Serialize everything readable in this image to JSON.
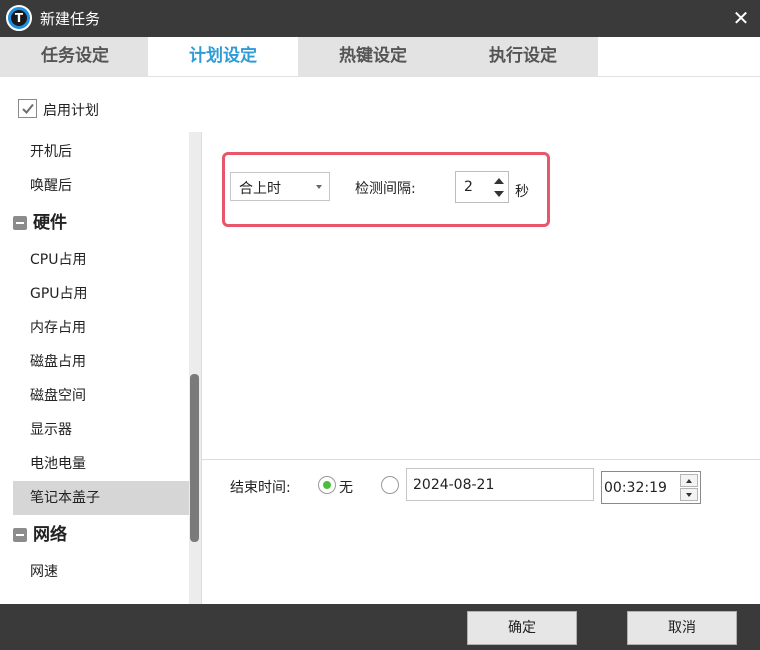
{
  "window": {
    "title": "新建任务",
    "icon_letter": "T"
  },
  "tabs": [
    {
      "label": "任务设定",
      "active": false
    },
    {
      "label": "计划设定",
      "active": true
    },
    {
      "label": "热键设定",
      "active": false
    },
    {
      "label": "执行设定",
      "active": false
    }
  ],
  "enable_plan": {
    "label": "启用计划",
    "checked": true
  },
  "sidebar": {
    "items": [
      {
        "kind": "item",
        "label": "开机后"
      },
      {
        "kind": "item",
        "label": "唤醒后"
      },
      {
        "kind": "group",
        "label": "硬件"
      },
      {
        "kind": "item",
        "label": "CPU占用"
      },
      {
        "kind": "item",
        "label": "GPU占用"
      },
      {
        "kind": "item",
        "label": "内存占用"
      },
      {
        "kind": "item",
        "label": "磁盘占用"
      },
      {
        "kind": "item",
        "label": "磁盘空间"
      },
      {
        "kind": "item",
        "label": "显示器"
      },
      {
        "kind": "item",
        "label": "电池电量"
      },
      {
        "kind": "item",
        "label": "笔记本盖子",
        "selected": true
      },
      {
        "kind": "group",
        "label": "网络"
      },
      {
        "kind": "item",
        "label": "网速"
      }
    ]
  },
  "condition": {
    "select_value": "合上时",
    "interval_label": "检测间隔:",
    "interval_value": "2",
    "interval_unit": "秒"
  },
  "end_time": {
    "label": "结束时间:",
    "none_label": "无",
    "none_checked": true,
    "date_checked": false,
    "date_value": "2024-08-21",
    "time_value": "00:32:19"
  },
  "footer": {
    "ok_label": "确定",
    "cancel_label": "取消"
  },
  "colors": {
    "accent": "#2e9bd6",
    "highlight": "#e8566c",
    "titlebar": "#3a3a3a",
    "radio_dot": "#4bbf3b"
  }
}
